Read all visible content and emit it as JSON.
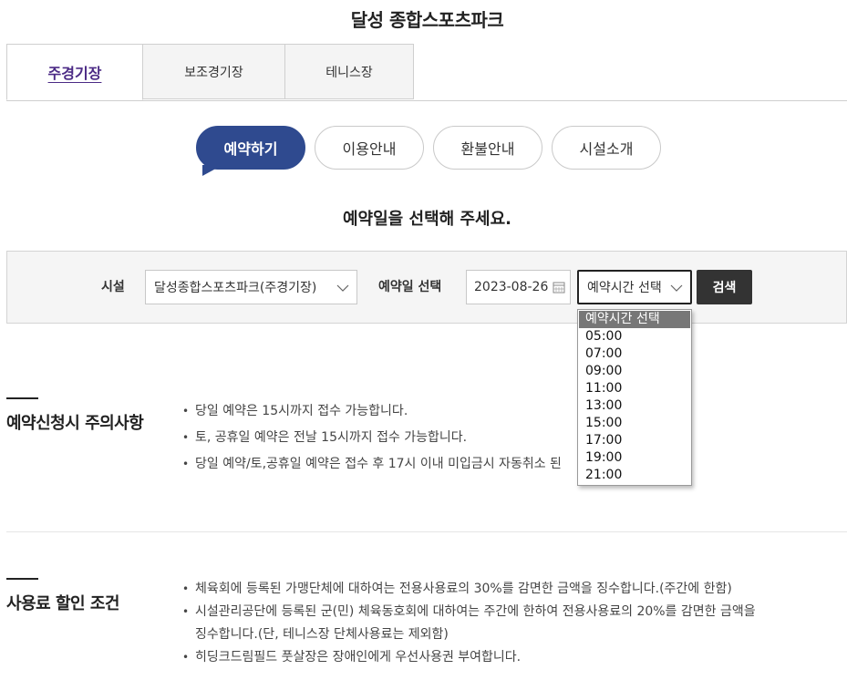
{
  "page_title": "달성 종합스포츠파크",
  "facility_tabs": [
    {
      "label": "주경기장",
      "active": true
    },
    {
      "label": "보조경기장",
      "active": false
    },
    {
      "label": "테니스장",
      "active": false
    }
  ],
  "sub_tabs": [
    {
      "label": "예약하기",
      "active": true
    },
    {
      "label": "이용안내",
      "active": false
    },
    {
      "label": "환불안내",
      "active": false
    },
    {
      "label": "시설소개",
      "active": false
    }
  ],
  "prompt": "예약일을 선택해 주세요.",
  "search": {
    "facility_label": "시설",
    "facility_value": "달성종합스포츠파크(주경기장)",
    "date_label": "예약일 선택",
    "date_value": "2023-08-26",
    "time_value": "예약시간 선택",
    "search_button": "검색"
  },
  "time_options": [
    "예약시간 선택",
    "05:00",
    "07:00",
    "09:00",
    "11:00",
    "13:00",
    "15:00",
    "17:00",
    "19:00",
    "21:00"
  ],
  "notice": {
    "title": "예약신청시 주의사항",
    "items": [
      "당일 예약은 15시까지 접수 가능합니다.",
      "토, 공휴일 예약은 전날 15시까지 접수 가능합니다.",
      "당일 예약/토,공휴일 예약은 접수 후 17시 이내 미입금시 자동취소 된"
    ]
  },
  "discount": {
    "title": "사용료 할인 조건",
    "items": [
      "체육회에 등록된 가맹단체에 대하여는 전용사용료의 30%를 감면한 금액을 징수합니다.(주간에 한함)",
      "시설관리공단에 등록된 군(민) 체육동호회에 대하여는 주간에 한하여 전용사용료의 20%를 감면한 금액을",
      "징수합니다.(단, 테니스장 단체사용료는 제외함)",
      "히딩크드림필드 풋살장은 장애인에게 우선사용권 부여합니다."
    ]
  },
  "colors": {
    "accent": "#2f4a8f",
    "active_tab_text": "#4b2a85",
    "button": "#333333"
  }
}
